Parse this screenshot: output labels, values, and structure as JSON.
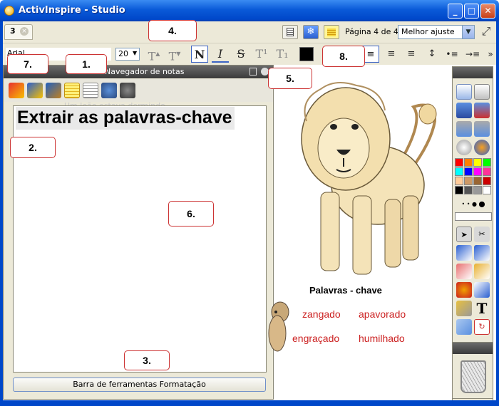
{
  "window": {
    "title": "ActivInspire - Studio"
  },
  "tabs": {
    "active_tab": "3"
  },
  "toolbar": {
    "page_label": "Página 4 de 4",
    "zoom_value": "Melhor ajuste",
    "font_name": "Arial",
    "font_size": "20",
    "bold_label": "N",
    "italic_label": "I",
    "strike_label": "S",
    "superscript_label": "T¹",
    "subscript_label": "T₁",
    "grow_label": "T",
    "shrink_label": "T",
    "text_color": "#000000"
  },
  "panel": {
    "title": "Navegador de notas",
    "ghost_text": "Um leão estava dormindo",
    "note_heading": "Extrair as palavras-chave",
    "bottom_button": "Barra de ferramentas Formatação"
  },
  "canvas": {
    "caption": "Palavras - chave",
    "words": [
      "zangado",
      "apavorado",
      "engraçado",
      "humilhado"
    ],
    "word_color": "#cc2222"
  },
  "palette": {
    "colors": [
      "#ff0000",
      "#ff8000",
      "#ffff00",
      "#00ff00",
      "#00ffff",
      "#0000ff",
      "#ff00ff",
      "#ff3399",
      "#ffcc99",
      "#cc9966",
      "#996633",
      "#cc0000",
      "#000000",
      "#555555",
      "#999999",
      "#ffffff"
    ]
  },
  "callouts": {
    "c1": "1.",
    "c2": "2.",
    "c3": "3.",
    "c4": "4.",
    "c5": "5.",
    "c6": "6.",
    "c7": "7.",
    "c8": "8."
  },
  "icons": [
    "app-logo-icon",
    "minimize-icon",
    "maximize-icon",
    "close-icon",
    "tab-close-icon",
    "page-sorter-icon",
    "resource-icon",
    "notes-icon",
    "fullscreen-icon",
    "color-swatch-icon",
    "align-left-icon",
    "align-center-icon",
    "align-right-icon",
    "line-spacing-icon",
    "trash-icon"
  ]
}
